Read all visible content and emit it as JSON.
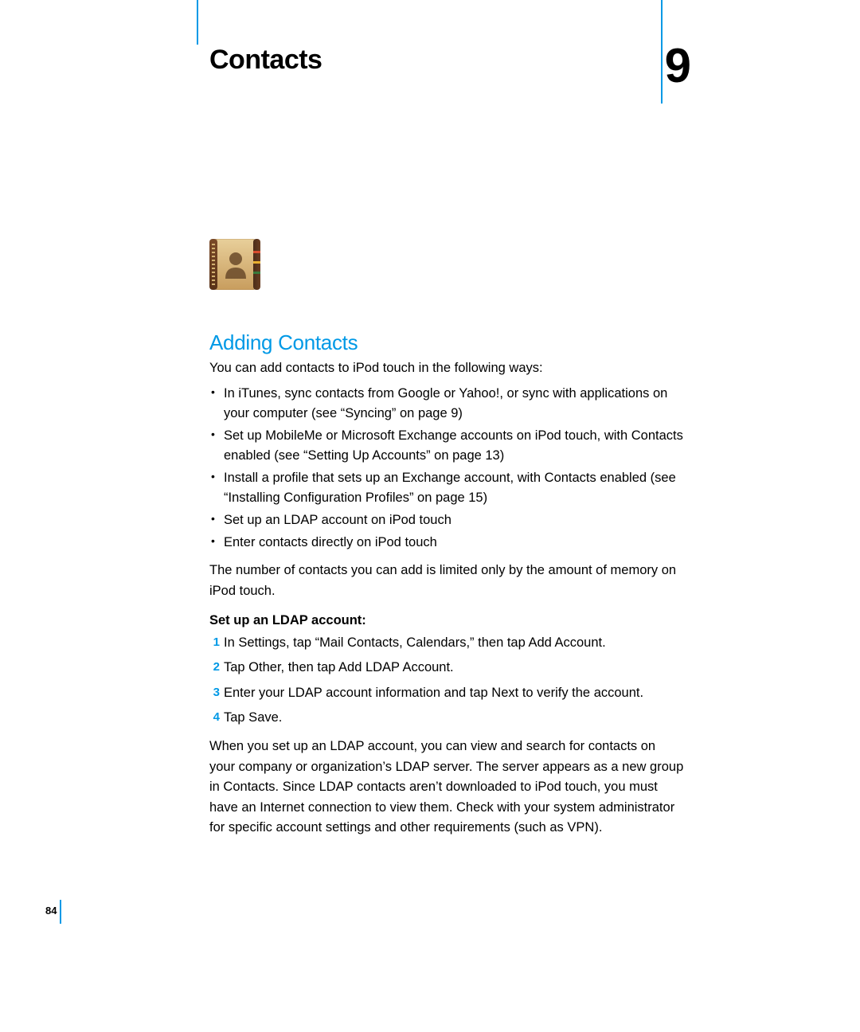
{
  "chapter": {
    "title": "Contacts",
    "number": "9"
  },
  "section": {
    "heading": "Adding Contacts",
    "intro": "You can add contacts to iPod touch in the following ways:",
    "bullets": [
      "In iTunes, sync contacts from Google or Yahoo!, or sync with applications on your computer (see “Syncing” on page 9)",
      "Set up MobileMe or Microsoft Exchange accounts on iPod touch, with Contacts enabled (see “Setting Up Accounts” on page 13)",
      "Install a profile that sets up an Exchange account, with Contacts enabled (see “Installing Configuration Profiles” on page 15)",
      "Set up an LDAP account on iPod touch",
      "Enter contacts directly on iPod touch"
    ],
    "limit_para": "The number of contacts you can add is limited only by the amount of memory on iPod touch.",
    "ldap_heading": "Set up an LDAP account:",
    "steps": [
      {
        "n": "1",
        "text": "In Settings, tap “Mail Contacts, Calendars,” then tap Add Account."
      },
      {
        "n": "2",
        "text": "Tap Other, then tap Add LDAP Account."
      },
      {
        "n": "3",
        "text": "Enter your LDAP account information and tap Next to verify the account."
      },
      {
        "n": "4",
        "text": "Tap Save."
      }
    ],
    "ldap_para": "When you set up an LDAP account, you can view and search for contacts on your company or organization’s LDAP server. The server appears as a new group in Contacts. Since LDAP contacts aren’t downloaded to iPod touch, you must have an Internet connection to view them. Check with your system administrator for specific account settings and other requirements (such as VPN)."
  },
  "page_number": "84",
  "icon_name": "contacts-app-icon"
}
